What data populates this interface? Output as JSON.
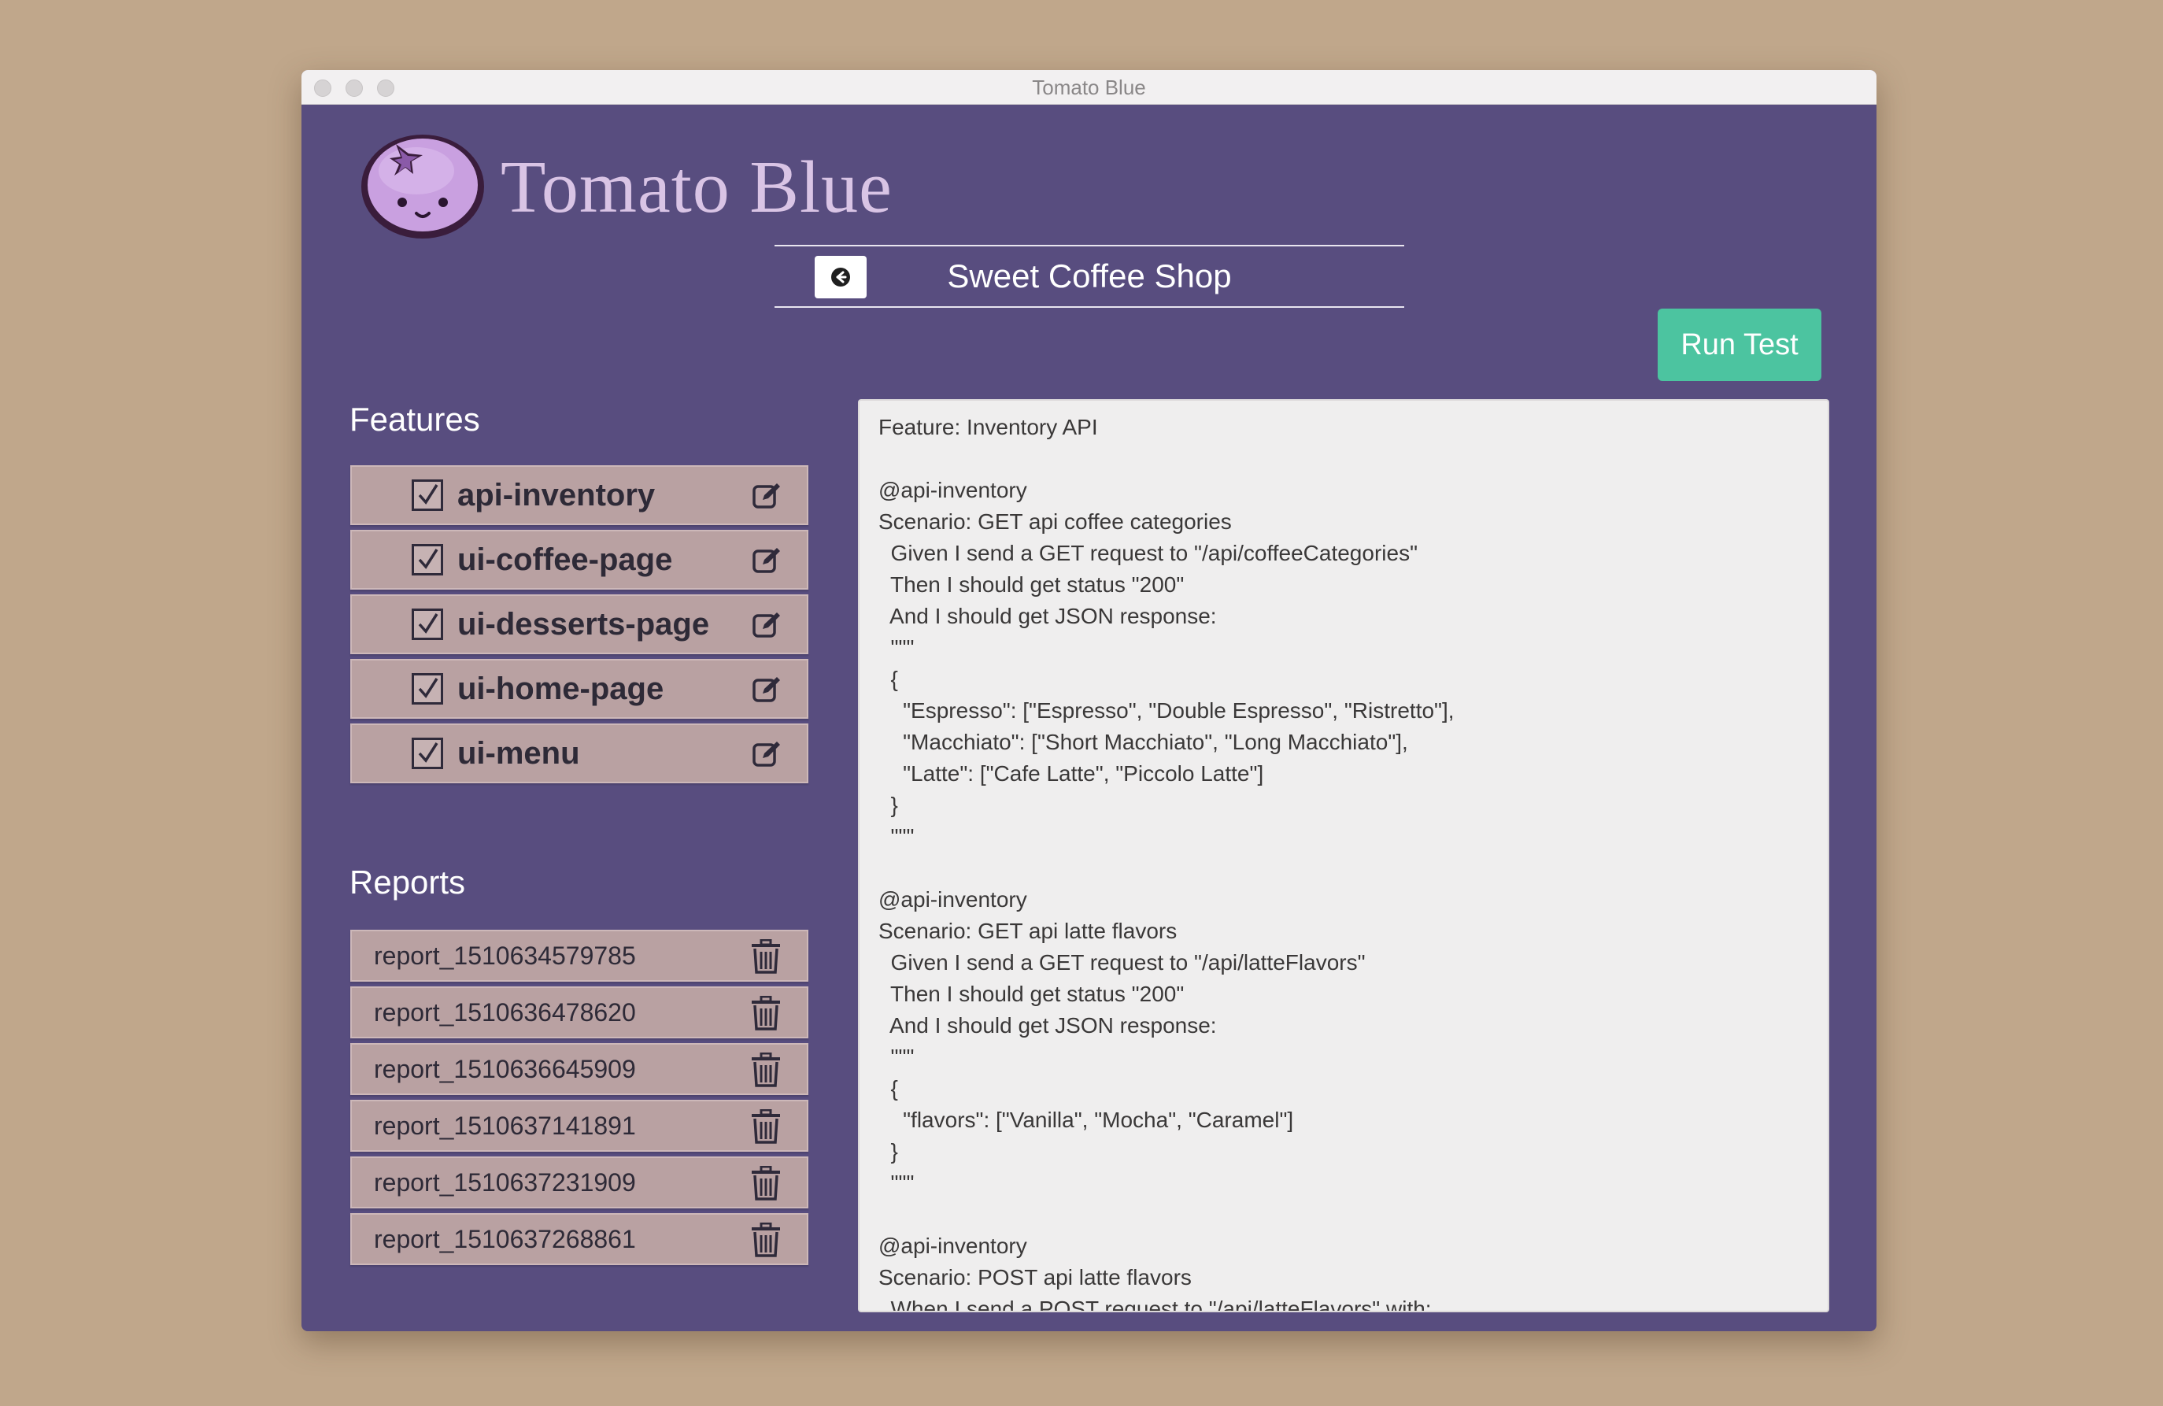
{
  "window": {
    "title": "Tomato Blue"
  },
  "header": {
    "app_title": "Tomato Blue",
    "project_name": "Sweet Coffee Shop",
    "run_button_label": "Run Test"
  },
  "features": {
    "title": "Features",
    "items": [
      {
        "label": "api-inventory",
        "checked": true
      },
      {
        "label": "ui-coffee-page",
        "checked": true
      },
      {
        "label": "ui-desserts-page",
        "checked": true
      },
      {
        "label": "ui-home-page",
        "checked": true
      },
      {
        "label": "ui-menu",
        "checked": true
      }
    ]
  },
  "reports": {
    "title": "Reports",
    "items": [
      {
        "label": "report_1510634579785"
      },
      {
        "label": "report_1510636478620"
      },
      {
        "label": "report_1510636645909"
      },
      {
        "label": "report_1510637141891"
      },
      {
        "label": "report_1510637231909"
      },
      {
        "label": "report_1510637268861"
      }
    ]
  },
  "editor": {
    "content": "Feature: Inventory API\n\n@api-inventory\nScenario: GET api coffee categories\n  Given I send a GET request to \"/api/coffeeCategories\"\n  Then I should get status \"200\"\n  And I should get JSON response:\n  \"\"\"\n  {\n    \"Espresso\": [\"Espresso\", \"Double Espresso\", \"Ristretto\"],\n    \"Macchiato\": [\"Short Macchiato\", \"Long Macchiato\"],\n    \"Latte\": [\"Cafe Latte\", \"Piccolo Latte\"]\n  }\n  \"\"\"\n\n@api-inventory\nScenario: GET api latte flavors\n  Given I send a GET request to \"/api/latteFlavors\"\n  Then I should get status \"200\"\n  And I should get JSON response:\n  \"\"\"\n  {\n    \"flavors\": [\"Vanilla\", \"Mocha\", \"Caramel\"]\n  }\n  \"\"\"\n\n@api-inventory\nScenario: POST api latte flavors\n  When I send a POST request to \"/api/latteFlavors\" with:"
  },
  "icons": {
    "logo": "tomato-blue-logo",
    "back": "back-arrow-icon",
    "edit": "edit-icon",
    "trash": "trash-icon",
    "checkbox": "checkbox-checked-icon"
  },
  "colors": {
    "background": "#c0a78b",
    "window": "#584d7f",
    "accent_button": "#4cc4a0",
    "list_item": "#b9a1a2",
    "editor_bg": "#efeeee",
    "title_text": "#d9c4e5"
  }
}
